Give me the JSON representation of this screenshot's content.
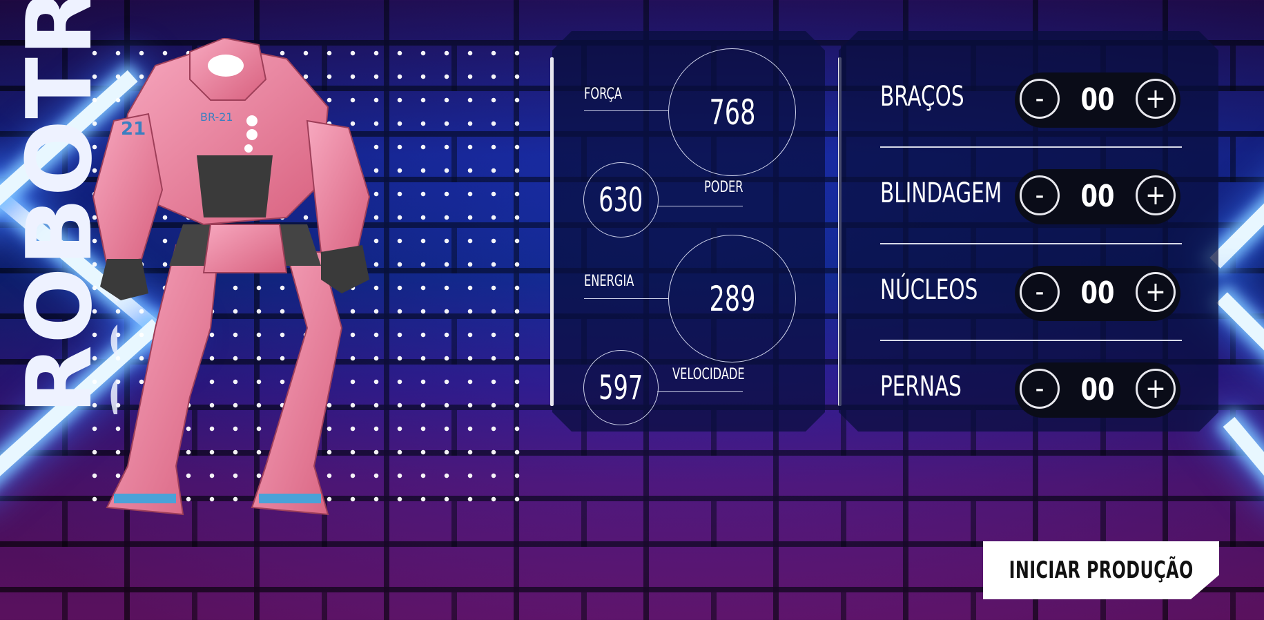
{
  "brand": {
    "line1": "ROBOTRON",
    "line2": "2000"
  },
  "robot": {
    "badge": "BR-21",
    "number": "21",
    "color": "#f08aa8"
  },
  "stats": {
    "forca": {
      "label": "FORÇA",
      "value": "768"
    },
    "poder": {
      "label": "PODER",
      "value": "630"
    },
    "energia": {
      "label": "ENERGIA",
      "value": "289"
    },
    "velocidade": {
      "label": "VELOCIDADE",
      "value": "597"
    }
  },
  "parts": [
    {
      "label": "BRAÇOS",
      "minus": "-",
      "value": "00",
      "plus": "+"
    },
    {
      "label": "BLINDAGEM",
      "minus": "-",
      "value": "00",
      "plus": "+"
    },
    {
      "label": "NÚCLEOS",
      "minus": "-",
      "value": "00",
      "plus": "+"
    },
    {
      "label": "PERNAS",
      "minus": "-",
      "value": "00",
      "plus": "+"
    }
  ],
  "cta": {
    "label": "INICIAR PRODUÇÃO"
  },
  "colors": {
    "panel": "#080e3c",
    "accent_neon": "#e8f7ff",
    "robot_pink": "#f08aa8"
  }
}
